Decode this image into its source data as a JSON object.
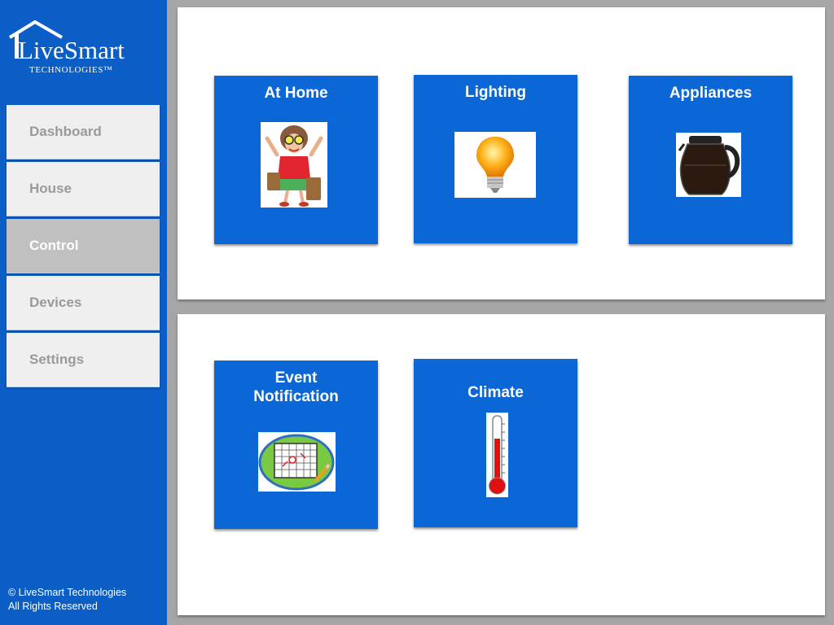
{
  "brand": {
    "logo_name": "LiveSmart",
    "logo_tagline": "TECHNOLOGIES™"
  },
  "sidebar": {
    "items": [
      {
        "label": "Dashboard",
        "active": false
      },
      {
        "label": "House",
        "active": false
      },
      {
        "label": "Control",
        "active": true
      },
      {
        "label": "Devices",
        "active": false
      },
      {
        "label": "Settings",
        "active": false
      }
    ]
  },
  "footer": {
    "line1": "© LiveSmart Technologies",
    "line2": "All Rights Reserved"
  },
  "tiles": {
    "at_home": {
      "title": "At Home",
      "icon": "person-with-luggage-icon"
    },
    "lighting": {
      "title": "Lighting",
      "icon": "light-bulb-icon"
    },
    "appliances": {
      "title": "Appliances",
      "icon": "coffee-pot-icon"
    },
    "event_notification": {
      "title_line1": "Event",
      "title_line2": "Notification",
      "icon": "calendar-icon"
    },
    "climate": {
      "title": "Climate",
      "icon": "thermometer-icon"
    }
  },
  "colors": {
    "sidebar_blue": "#0b5ec6",
    "tile_blue": "#0b66d6",
    "active_nav": "#c0c0c0",
    "background": "#a6a6a6"
  }
}
